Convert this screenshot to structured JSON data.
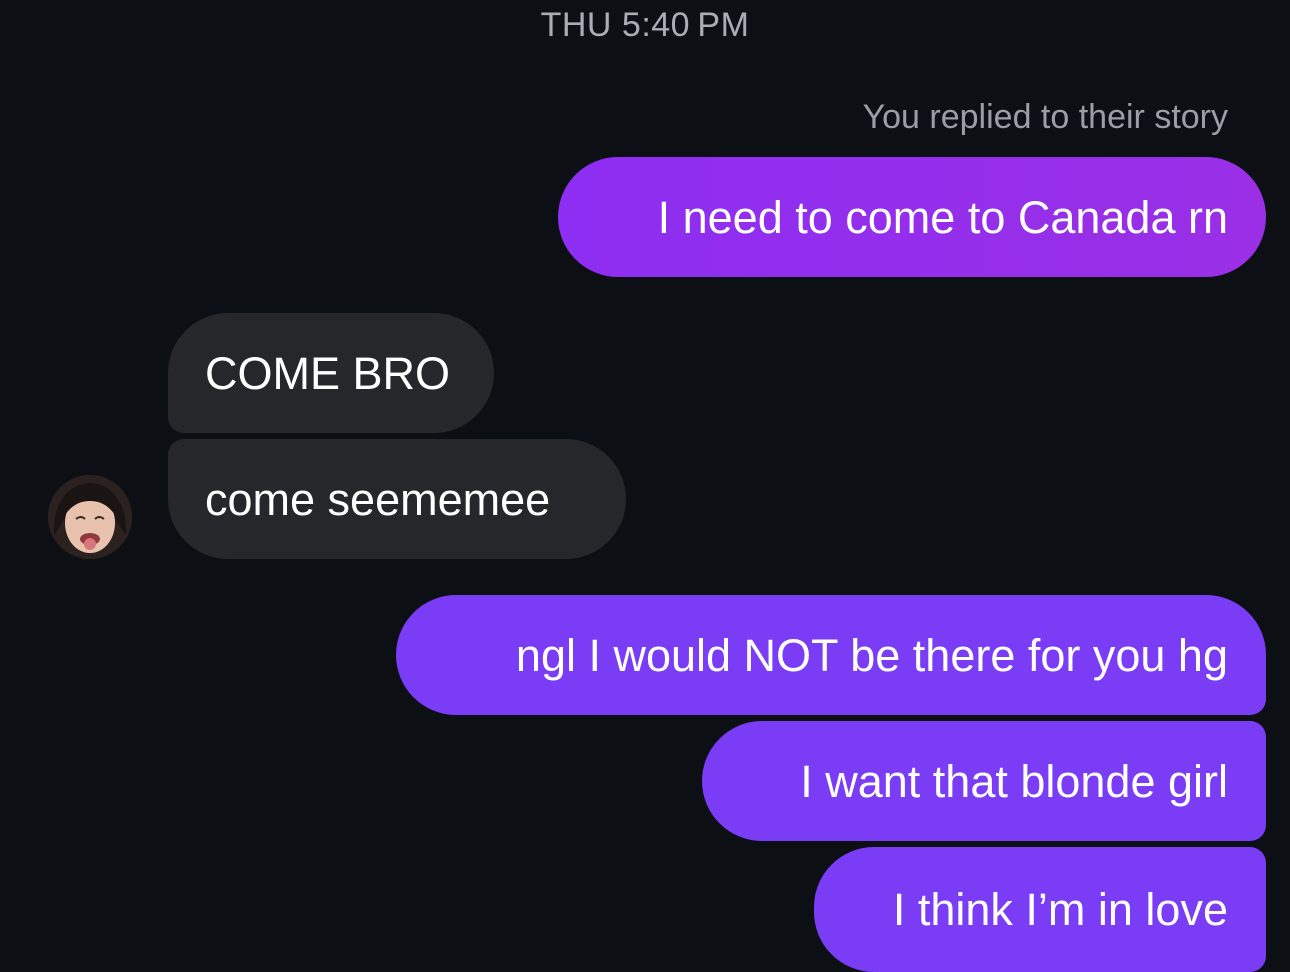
{
  "header": {
    "timestamp": "THU 5:40 PM"
  },
  "thread": {
    "story_reply_note": "You replied to their story",
    "messages": [
      {
        "from": "me",
        "text": "I need to come to Canada rn"
      },
      {
        "from": "them",
        "text": "COME BRO"
      },
      {
        "from": "them",
        "text": "come seememee"
      },
      {
        "from": "me",
        "text": "ngl I would NOT be there for you hg"
      },
      {
        "from": "me",
        "text": "I want that blonde girl"
      },
      {
        "from": "me",
        "text": "I think I’m in love"
      }
    ]
  },
  "contact": {
    "avatar_icon": "profile-photo"
  },
  "colors": {
    "background": "#0c0f14",
    "sent_bubble": "#7a3cf5",
    "sent_bubble_story_reply": "#8e2ef2",
    "received_bubble": "#25272b",
    "meta_text": "#a9adb4"
  }
}
